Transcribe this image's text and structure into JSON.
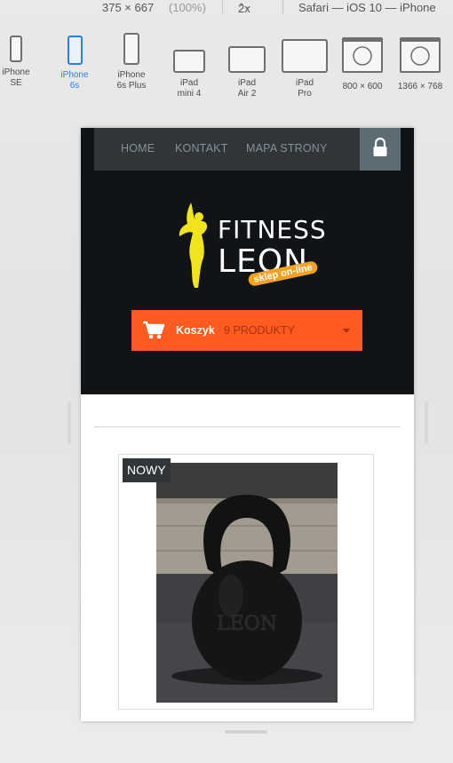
{
  "toolbar": {
    "size": "375 × 667",
    "percent": "(100%)",
    "scale": "2x",
    "browser": "Safari — iOS 10 — iPhone"
  },
  "devices": [
    {
      "line1": "iPhone",
      "line2": "SE",
      "icon": "phone-icon"
    },
    {
      "line1": "iPhone",
      "line2": "6s",
      "icon": "phone-icon",
      "active": true
    },
    {
      "line1": "iPhone",
      "line2": "6s Plus",
      "icon": "phone-icon"
    },
    {
      "line1": "iPad",
      "line2": "mini 4",
      "icon": "tablet-icon"
    },
    {
      "line1": "iPad",
      "line2": "Air 2",
      "icon": "tablet-icon"
    },
    {
      "line1": "iPad",
      "line2": "Pro",
      "icon": "tablet-icon"
    },
    {
      "line1": "800 × 600",
      "line2": "",
      "icon": "compass-window-icon"
    },
    {
      "line1": "1366 × 768",
      "line2": "",
      "icon": "compass-window-icon"
    }
  ],
  "site": {
    "nav": [
      "HOME",
      "KONTAKT",
      "MAPA STRONY"
    ],
    "logo": {
      "line1": "FITNESS",
      "line2": "LEON",
      "ribbon": "sklep on-line"
    },
    "cart": {
      "label": "Koszyk",
      "count": "9 PRODUKTY"
    },
    "product": {
      "badge": "NOWY",
      "engraving": "LEON"
    }
  },
  "colors": {
    "accent": "#ff5a1f",
    "header_bg": "#111416",
    "nav_bg": "#2f3539",
    "active_device": "#2b7fe3"
  }
}
